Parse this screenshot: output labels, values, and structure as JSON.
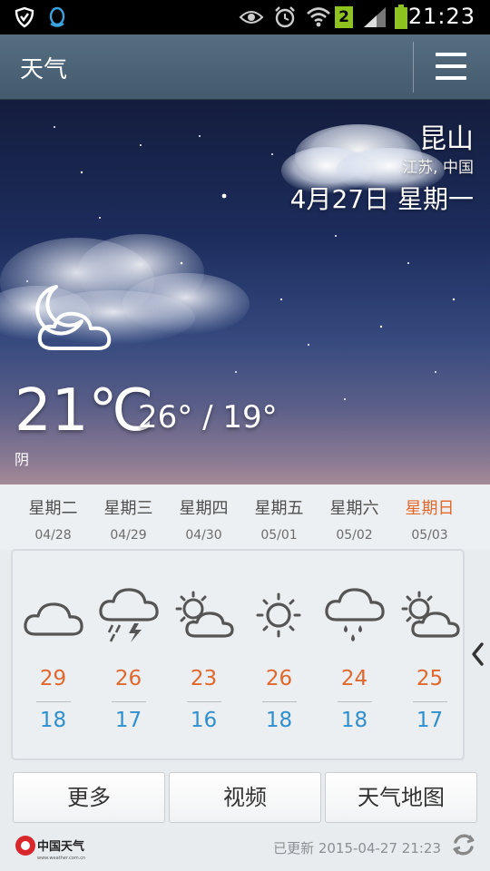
{
  "status_bar": {
    "time": "21:23",
    "sim_label": "2",
    "icons": [
      "shield-icon",
      "qq-penguin-icon",
      "eye-icon",
      "alarm-icon",
      "wifi-icon",
      "sim-icon",
      "signal-icon",
      "battery-icon"
    ]
  },
  "app_bar": {
    "title": "天气",
    "menu_icon": "hamburger-menu-icon"
  },
  "current": {
    "city": "昆山",
    "region": "江苏, 中国",
    "date": "4月27日 星期一",
    "temperature": "21℃",
    "range": "26° / 19°",
    "condition": "阴",
    "icon": "moon-cloud-icon"
  },
  "forecast": [
    {
      "weekday": "星期二",
      "date": "04/28",
      "icon": "cloud-icon",
      "high": "29",
      "low": "18"
    },
    {
      "weekday": "星期三",
      "date": "04/29",
      "icon": "thunder-rain-icon",
      "high": "26",
      "low": "17"
    },
    {
      "weekday": "星期四",
      "date": "04/30",
      "icon": "sun-cloud-icon",
      "high": "23",
      "low": "16"
    },
    {
      "weekday": "星期五",
      "date": "05/01",
      "icon": "sun-icon",
      "high": "26",
      "low": "18"
    },
    {
      "weekday": "星期六",
      "date": "05/02",
      "icon": "rain-icon",
      "high": "24",
      "low": "18"
    },
    {
      "weekday": "星期日",
      "date": "05/03",
      "icon": "sun-cloud-icon",
      "high": "25",
      "low": "17"
    }
  ],
  "buttons": {
    "more": "更多",
    "video": "视频",
    "weather_map": "天气地图"
  },
  "footer": {
    "logo_text": "中国天气",
    "logo_url_text": "www.weather.com.cn",
    "updated": "已更新 2015-04-27 21:23"
  },
  "colors": {
    "high_temp": "#e0682e",
    "low_temp": "#2f8fcf",
    "weekend": "#e4682d"
  }
}
